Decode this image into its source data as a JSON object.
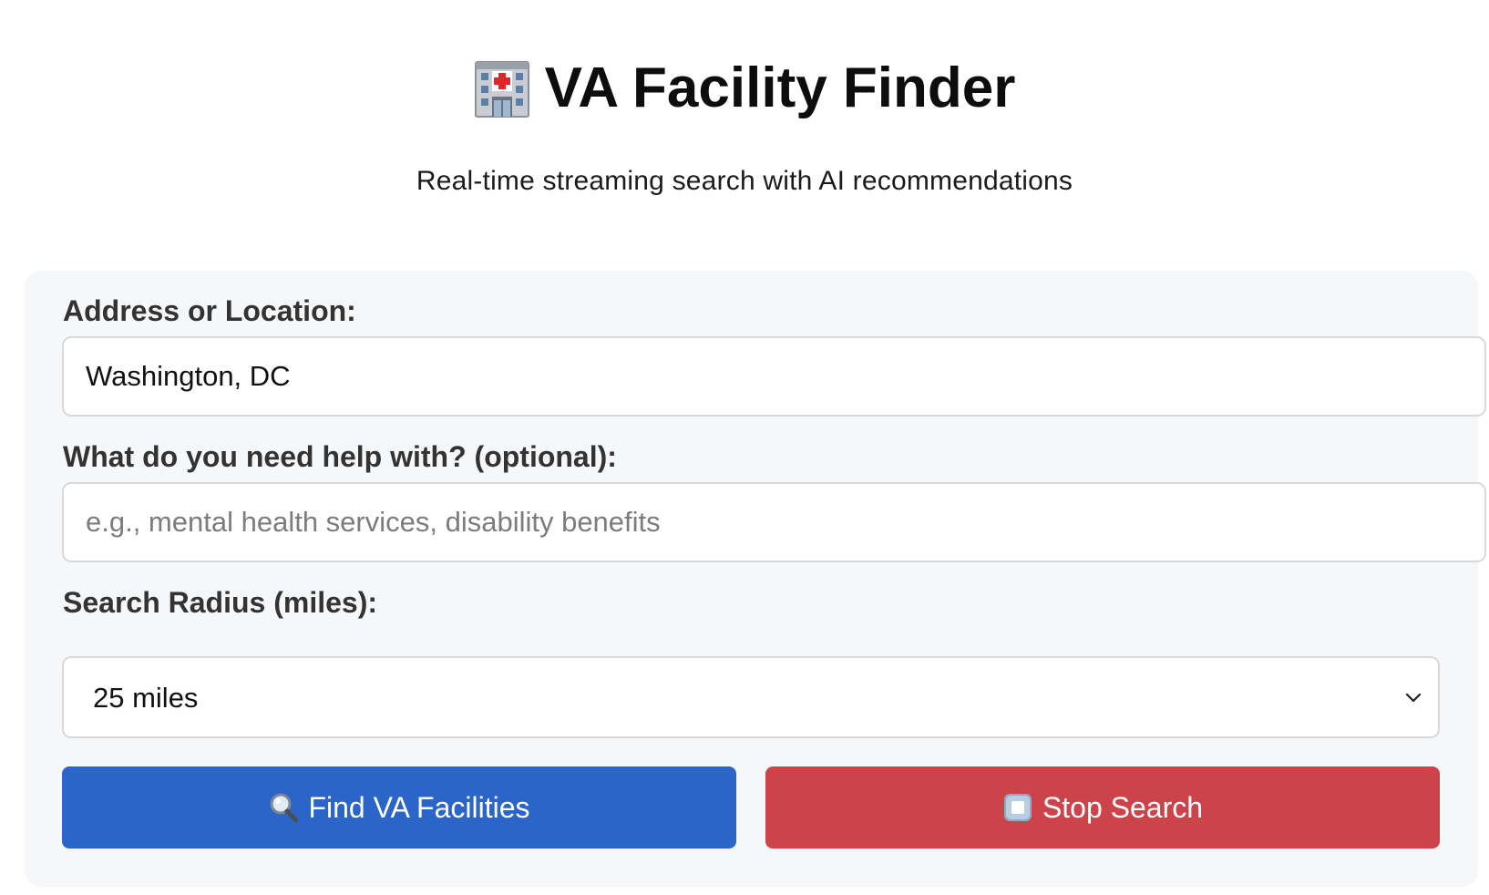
{
  "header": {
    "title": "VA Facility Finder",
    "title_icon": "hospital-icon",
    "subtitle": "Real-time streaming search with AI recommendations"
  },
  "form": {
    "address_label": "Address or Location:",
    "address_value": "Washington, DC",
    "help_label": "What do you need help with? (optional):",
    "help_placeholder": "e.g., mental health services, disability benefits",
    "help_value": "",
    "radius_label": "Search Radius (miles):",
    "radius_selected": "25 miles",
    "find_button": {
      "label": "Find VA Facilities",
      "icon": "magnifier-icon"
    },
    "stop_button": {
      "label": "Stop Search",
      "icon": "stop-icon"
    }
  },
  "colors": {
    "find_button_bg": "#2b65c7",
    "stop_button_bg": "#cc434a",
    "panel_bg": "#f6f7f9"
  }
}
